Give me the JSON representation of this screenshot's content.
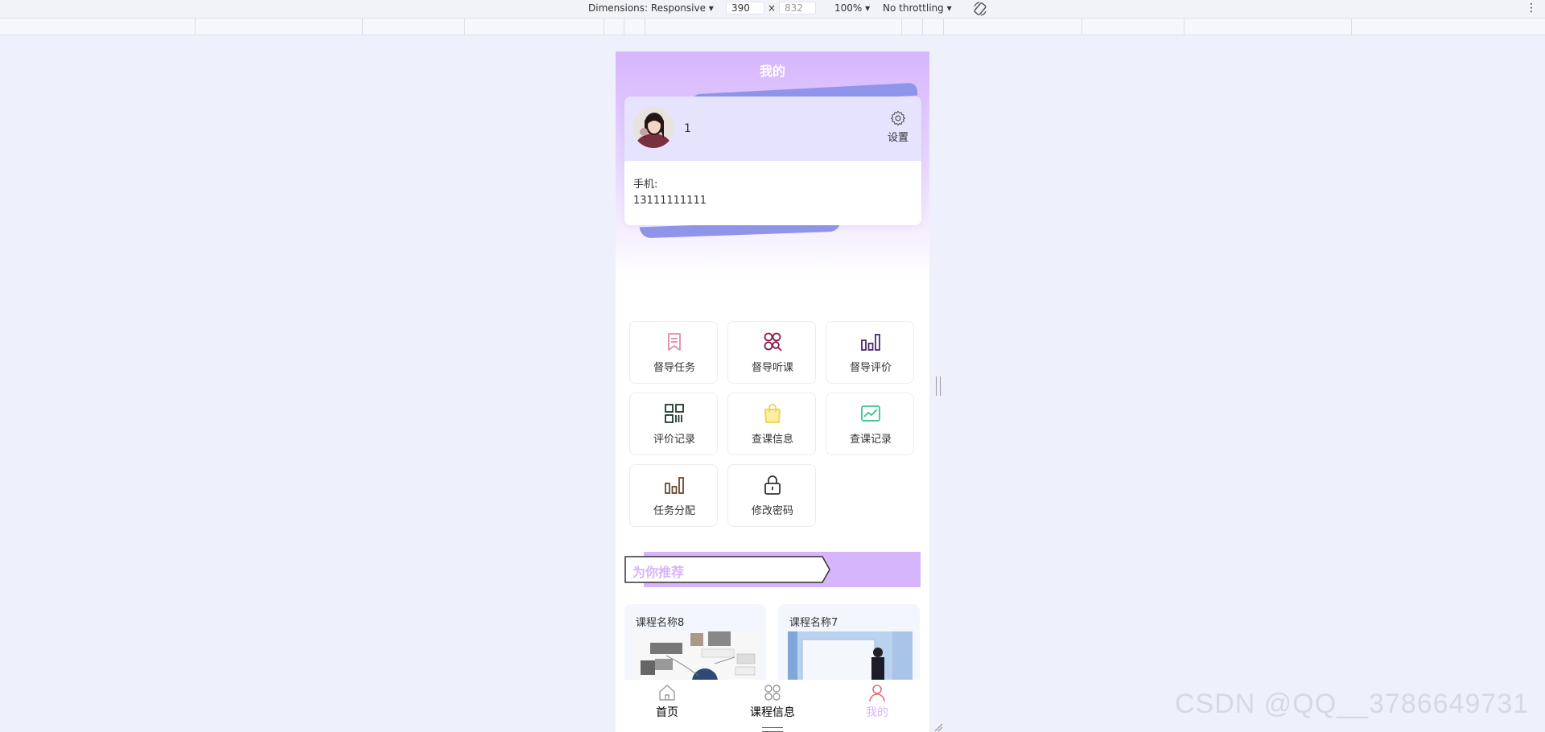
{
  "devtools": {
    "dimensions_label": "Dimensions: Responsive ▾",
    "width": "390",
    "times": "×",
    "height": "832",
    "zoom": "100% ▾",
    "throttling": "No throttling ▾",
    "more": "⋮"
  },
  "header": {
    "title": "我的"
  },
  "profile": {
    "username": "1",
    "settings_label": "设置",
    "phone_label": "手机:",
    "phone_value": "13111111111"
  },
  "menu": [
    {
      "label": "督导任务",
      "icon": "bookmark-icon",
      "color": "#e08aa6"
    },
    {
      "label": "督导听课",
      "icon": "circles-search-icon",
      "color": "#8b1d4d"
    },
    {
      "label": "督导评价",
      "icon": "bar-chart-icon",
      "color": "#4b2a6b"
    },
    {
      "label": "评价记录",
      "icon": "qrcode-icon",
      "color": "#1f3b2b"
    },
    {
      "label": "查课信息",
      "icon": "shopping-bag-icon",
      "color": "#f0d24a"
    },
    {
      "label": "查课记录",
      "icon": "image-chart-icon",
      "color": "#3cc48e"
    },
    {
      "label": "任务分配",
      "icon": "bar-chart-icon",
      "color": "#6a4a2a"
    },
    {
      "label": "修改密码",
      "icon": "lock-icon",
      "color": "#333333"
    }
  ],
  "recommend": {
    "title": "为你推荐"
  },
  "courses": [
    {
      "name": "课程名称8"
    },
    {
      "name": "课程名称7"
    }
  ],
  "tabbar": [
    {
      "label": "首页",
      "icon": "home-icon"
    },
    {
      "label": "课程信息",
      "icon": "grid-icon"
    },
    {
      "label": "我的",
      "icon": "user-icon"
    }
  ],
  "watermark": "CSDN @QQ__3786649731",
  "colors": {
    "accent": "#d6b5fd",
    "card_top": "#e6e3fe",
    "page_bg": "#eef1fb"
  }
}
